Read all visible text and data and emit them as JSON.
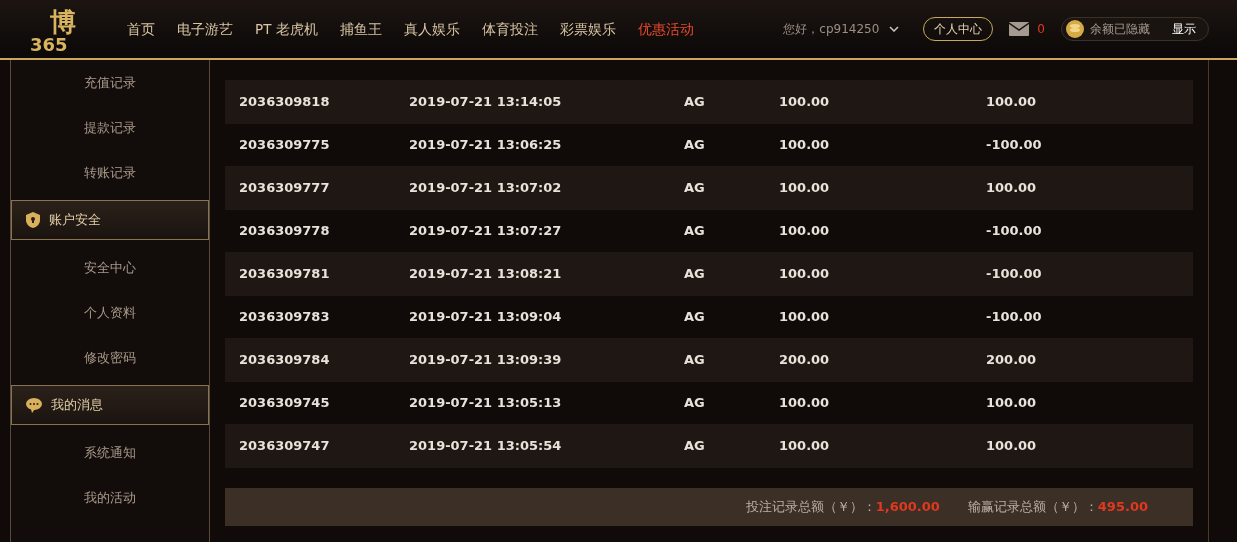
{
  "logo": {
    "text": "博",
    "sub": "365"
  },
  "nav": [
    {
      "label": "首页",
      "highlight": false
    },
    {
      "label": "电子游艺",
      "highlight": false
    },
    {
      "label": "PT 老虎机",
      "highlight": false
    },
    {
      "label": "捕鱼王",
      "highlight": false
    },
    {
      "label": "真人娱乐",
      "highlight": false
    },
    {
      "label": "体育投注",
      "highlight": false
    },
    {
      "label": "彩票娱乐",
      "highlight": false
    },
    {
      "label": "优惠活动",
      "highlight": true
    }
  ],
  "user": {
    "greeting": "您好，cp914250",
    "center_button": "个人中心",
    "messages": "0",
    "balance": "余额已隐藏",
    "show_button": "显示"
  },
  "sidebar": [
    {
      "kind": "item",
      "label": "充值记录"
    },
    {
      "kind": "item",
      "label": "提款记录"
    },
    {
      "kind": "item",
      "label": "转账记录"
    },
    {
      "kind": "section",
      "label": "账户安全"
    },
    {
      "kind": "item",
      "label": "安全中心"
    },
    {
      "kind": "item",
      "label": "个人资料"
    },
    {
      "kind": "item",
      "label": "修改密码"
    },
    {
      "kind": "section",
      "label": "我的消息"
    },
    {
      "kind": "item",
      "label": "系统通知"
    },
    {
      "kind": "item",
      "label": "我的活动"
    }
  ],
  "rows": [
    [
      "2036309818",
      "2019-07-21 13:14:05",
      "AG",
      "100.00",
      "100.00"
    ],
    [
      "2036309775",
      "2019-07-21 13:06:25",
      "AG",
      "100.00",
      "-100.00"
    ],
    [
      "2036309777",
      "2019-07-21 13:07:02",
      "AG",
      "100.00",
      "100.00"
    ],
    [
      "2036309778",
      "2019-07-21 13:07:27",
      "AG",
      "100.00",
      "-100.00"
    ],
    [
      "2036309781",
      "2019-07-21 13:08:21",
      "AG",
      "100.00",
      "-100.00"
    ],
    [
      "2036309783",
      "2019-07-21 13:09:04",
      "AG",
      "100.00",
      "-100.00"
    ],
    [
      "2036309784",
      "2019-07-21 13:09:39",
      "AG",
      "200.00",
      "200.00"
    ],
    [
      "2036309745",
      "2019-07-21 13:05:13",
      "AG",
      "100.00",
      "100.00"
    ],
    [
      "2036309747",
      "2019-07-21 13:05:54",
      "AG",
      "100.00",
      "100.00"
    ]
  ],
  "summary": [
    {
      "label": "投注记录总额（￥）：",
      "value": "1,600.00"
    },
    {
      "label": "输赢记录总额（￥）：",
      "value": "495.00"
    }
  ]
}
